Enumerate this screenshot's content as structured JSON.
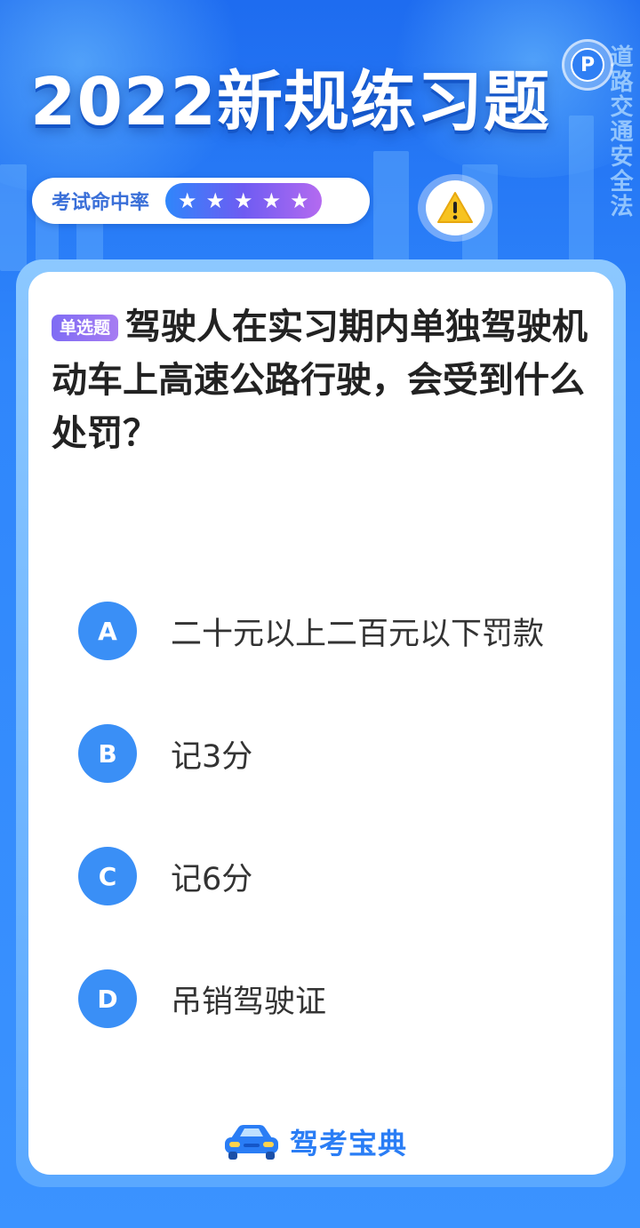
{
  "header": {
    "title": "2022新规练习题",
    "side_text": "道路交通安全法",
    "rate_label": "考试命中率",
    "stars": [
      "★",
      "★",
      "★",
      "★",
      "★"
    ]
  },
  "question": {
    "tag": "单选题",
    "text": "驾驶人在实习期内单独驾驶机动车上高速公路行驶，会受到什么处罚？"
  },
  "options": [
    {
      "letter": "A",
      "text": "二十元以上二百元以下罚款"
    },
    {
      "letter": "B",
      "text": "记3分"
    },
    {
      "letter": "C",
      "text": "记6分"
    },
    {
      "letter": "D",
      "text": "吊销驾驶证"
    }
  ],
  "footer": {
    "brand": "驾考宝典"
  },
  "icons": {
    "logo": "parking-p-icon",
    "warning": "warning-triangle-icon",
    "car": "car-icon"
  },
  "colors": {
    "accent": "#3a8ff6",
    "tag_purple": "#7f6cf4",
    "warning_yellow": "#f7c320"
  }
}
